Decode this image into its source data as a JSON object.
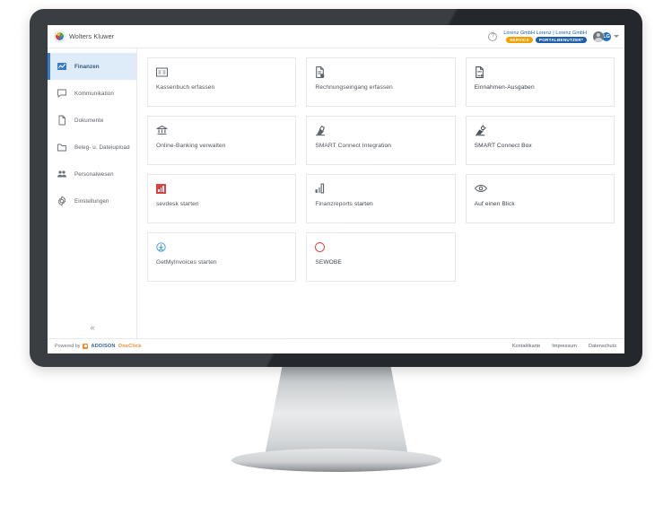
{
  "header": {
    "brand_name": "Wolters Kluwer",
    "brand_logo_icon": "wolters-kluwer-logo",
    "help_icon": "help-question-icon",
    "help_glyph": "?",
    "user_name": "Lorenz GmbH Lorenz | Lorenz GmbH",
    "badges": [
      {
        "label": "SERVICE",
        "color": "#f0a000"
      },
      {
        "label": "PORTALBENUTZER*",
        "color": "#1f5fa9"
      }
    ],
    "avatar_icon": "user-avatar-icon",
    "initials": "LG",
    "chevron_icon": "chevron-down-icon"
  },
  "sidebar": {
    "collapse_label": "«",
    "items": [
      {
        "label": "Finanzen",
        "icon": "finance-chart-icon",
        "active": true
      },
      {
        "label": "Kommunikation",
        "icon": "speech-bubble-icon",
        "active": false
      },
      {
        "label": "Dokumente",
        "icon": "document-page-icon",
        "active": false
      },
      {
        "label": "Beleg- u. Dateiupload",
        "icon": "folder-icon",
        "active": false
      },
      {
        "label": "Personalwesen",
        "icon": "people-group-icon",
        "active": false
      },
      {
        "label": "Einstellungen",
        "icon": "gear-icon",
        "active": false
      }
    ]
  },
  "main": {
    "cards": [
      {
        "label": "Kassenbuch erfassen",
        "icon": "cash-book-icon"
      },
      {
        "label": "Rechnungseingang erfassen",
        "icon": "invoice-document-icon"
      },
      {
        "label": "Einnahmen-Ausgaben",
        "icon": "income-expense-document-icon"
      },
      {
        "label": "Online-Banking verwalten",
        "icon": "bank-building-icon"
      },
      {
        "label": "SMART Connect Integration",
        "icon": "smart-connect-icon"
      },
      {
        "label": "SMART Connect Box",
        "icon": "smart-connect-box-icon"
      },
      {
        "label": "sevdesk starten",
        "icon": "sevdesk-logo-icon"
      },
      {
        "label": "Finanzreports starten",
        "icon": "bar-chart-icon"
      },
      {
        "label": "Auf einen Blick",
        "icon": "eye-icon"
      },
      {
        "label": "GetMyInvoices starten",
        "icon": "download-circle-icon"
      },
      {
        "label": "SEWOBE",
        "icon": "sewobe-ring-icon"
      }
    ]
  },
  "footer": {
    "powered_by": "Powered by",
    "addison": "ADDISON",
    "oneclick": "OneClick",
    "addison_icon": "addison-logo-icon",
    "links": [
      "Kontaktkarte",
      "Impressum",
      "Datenschutz"
    ]
  },
  "colors": {
    "accent_blue": "#1f6fc4",
    "active_nav_bg": "#dbe9f7",
    "service_orange": "#f0a000",
    "portal_blue": "#1f5fa9",
    "sevdesk_red": "#d92b2b",
    "sewobe_red": "#e0313b",
    "bezel": "#24282c"
  }
}
